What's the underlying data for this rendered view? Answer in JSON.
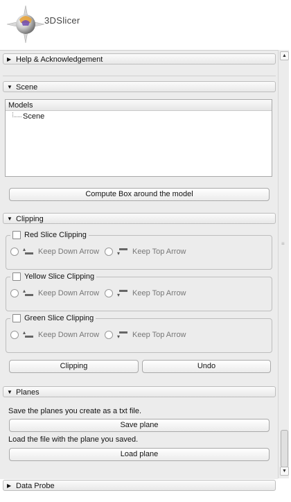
{
  "app": {
    "logo_text": "3DSlicer"
  },
  "sections": {
    "help": {
      "title": "Help & Acknowledgement",
      "expanded": false
    },
    "scene": {
      "title": "Scene",
      "expanded": true,
      "tree": {
        "column_header": "Models",
        "items": [
          "Scene"
        ]
      },
      "compute_button": "Compute Box around the model"
    },
    "clipping": {
      "title": "Clipping",
      "expanded": true,
      "groups": [
        {
          "label": "Red Slice Clipping",
          "checked": false,
          "option_down": "Keep Down Arrow",
          "option_top": "Keep Top Arrow"
        },
        {
          "label": "Yellow Slice Clipping",
          "checked": false,
          "option_down": "Keep Down Arrow",
          "option_top": "Keep Top Arrow"
        },
        {
          "label": "Green Slice Clipping",
          "checked": false,
          "option_down": "Keep Down Arrow",
          "option_top": "Keep Top Arrow"
        }
      ],
      "clipping_button": "Clipping",
      "undo_button": "Undo"
    },
    "planes": {
      "title": "Planes",
      "expanded": true,
      "save_text": "Save the planes you create as a txt file.",
      "save_button": "Save plane",
      "load_text": "Load the file with the plane you saved.",
      "load_button": "Load plane"
    },
    "data_probe": {
      "title": "Data Probe",
      "expanded": false
    }
  },
  "icons": {
    "collapsed": "triangle-right-icon",
    "expanded": "triangle-down-icon",
    "down_arrow": "keep-down-arrow-icon",
    "top_arrow": "keep-top-arrow-icon"
  }
}
